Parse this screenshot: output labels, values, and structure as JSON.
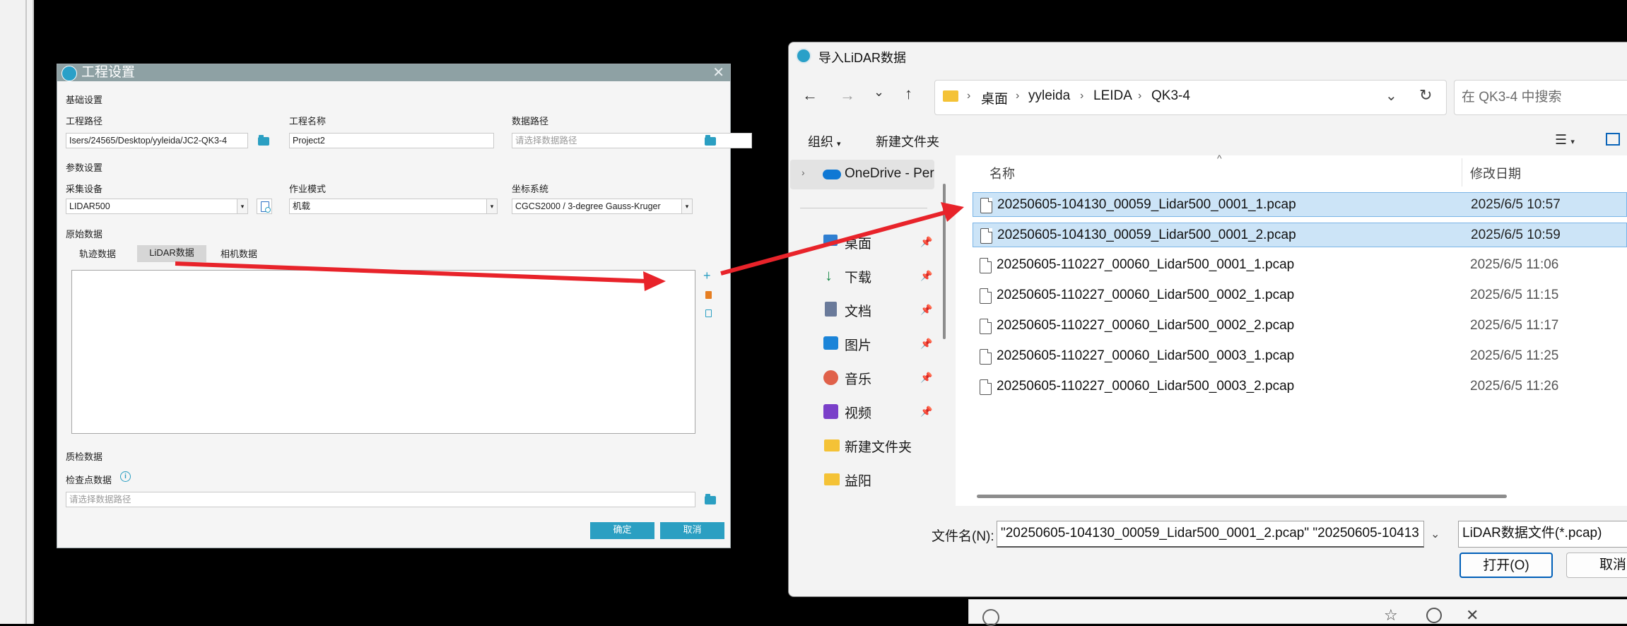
{
  "project_dialog": {
    "title": "工程设置",
    "basic_section": "基础设置",
    "project_path_label": "工程路径",
    "project_path_value": "Isers/24565/Desktop/yyleida/JC2-QK3-4",
    "project_name_label": "工程名称",
    "project_name_value": "Project2",
    "data_path_label": "数据路径",
    "data_path_placeholder": "请选择数据路径",
    "param_section": "参数设置",
    "device_label": "采集设备",
    "device_value": "LIDAR500",
    "mode_label": "作业模式",
    "mode_value": "机载",
    "coord_label": "坐标系统",
    "coord_value": "CGCS2000 / 3-degree Gauss-Kruger",
    "raw_section": "原始数据",
    "tabs": [
      "轨迹数据",
      "LiDAR数据",
      "相机数据"
    ],
    "selected_tab": "LiDAR数据",
    "qc_section": "质检数据",
    "checkpoint_label": "检查点数据",
    "checkpoint_placeholder": "请选择数据路径",
    "ok_label": "确定",
    "cancel_label": "取消"
  },
  "import_dialog": {
    "title": "导入LiDAR数据",
    "breadcrumb": [
      "桌面",
      "yyleida",
      "LEIDA",
      "QK3-4"
    ],
    "search_placeholder": "在 QK3-4 中搜索",
    "organize_label": "组织",
    "new_folder_label": "新建文件夹",
    "nav_items": [
      {
        "label": "OneDrive - Per",
        "icon": "cloud-icon",
        "pinned": false
      },
      {
        "label": "桌面",
        "icon": "desktop-icon",
        "pinned": true
      },
      {
        "label": "下载",
        "icon": "download-icon",
        "pinned": true
      },
      {
        "label": "文档",
        "icon": "document-icon",
        "pinned": true
      },
      {
        "label": "图片",
        "icon": "picture-icon",
        "pinned": true
      },
      {
        "label": "音乐",
        "icon": "music-icon",
        "pinned": true
      },
      {
        "label": "视频",
        "icon": "video-icon",
        "pinned": true
      },
      {
        "label": "新建文件夹",
        "icon": "folder-icon",
        "pinned": false
      },
      {
        "label": "益阳",
        "icon": "folder-icon",
        "pinned": false
      }
    ],
    "columns": [
      "名称",
      "修改日期"
    ],
    "files": [
      {
        "name": "20250605-104130_00059_Lidar500_0001_1.pcap",
        "date": "2025/6/5 10:57",
        "selected": true
      },
      {
        "name": "20250605-104130_00059_Lidar500_0001_2.pcap",
        "date": "2025/6/5 10:59",
        "selected": true
      },
      {
        "name": "20250605-110227_00060_Lidar500_0001_1.pcap",
        "date": "2025/6/5 11:06",
        "selected": false
      },
      {
        "name": "20250605-110227_00060_Lidar500_0002_1.pcap",
        "date": "2025/6/5 11:15",
        "selected": false
      },
      {
        "name": "20250605-110227_00060_Lidar500_0002_2.pcap",
        "date": "2025/6/5 11:17",
        "selected": false
      },
      {
        "name": "20250605-110227_00060_Lidar500_0003_1.pcap",
        "date": "2025/6/5 11:25",
        "selected": false
      },
      {
        "name": "20250605-110227_00060_Lidar500_0003_2.pcap",
        "date": "2025/6/5 11:26",
        "selected": false
      }
    ],
    "filename_label": "文件名(N):",
    "filename_value": "\"20250605-104130_00059_Lidar500_0001_2.pcap\" \"20250605-10413",
    "filetype_value": "LiDAR数据文件(*.pcap)",
    "open_label": "打开(O)",
    "cancel_label": "取消"
  },
  "colors": {
    "accent": "#2b9fc2",
    "arrow": "#e8232a",
    "selection": "#cce4f7"
  }
}
